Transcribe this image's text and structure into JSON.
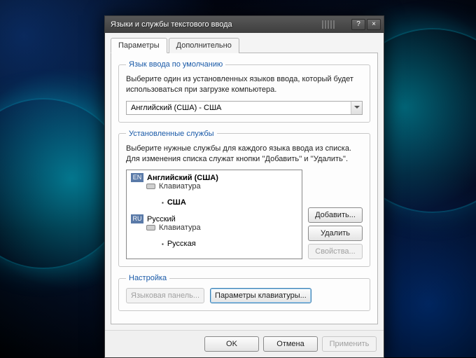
{
  "window": {
    "title": "Языки и службы текстового ввода",
    "help_icon": "?",
    "close_icon": "×"
  },
  "tabs": {
    "params": "Параметры",
    "advanced": "Дополнительно"
  },
  "default_lang": {
    "legend": "Язык ввода по умолчанию",
    "desc": "Выберите один из установленных языков ввода, который будет использоваться при загрузке компьютера.",
    "selected": "Английский (США) - США"
  },
  "installed": {
    "legend": "Установленные службы",
    "desc": "Выберите нужные службы для каждого языка ввода из списка. Для изменения списка служат кнопки ''Добавить'' и ''Удалить''.",
    "langs": [
      {
        "badge": "EN",
        "name": "Английский (США)",
        "bold": true,
        "keyboard_label": "Клавиатура",
        "layouts": [
          {
            "name": "США",
            "bold": true
          }
        ]
      },
      {
        "badge": "RU",
        "name": "Русский",
        "bold": false,
        "keyboard_label": "Клавиатура",
        "layouts": [
          {
            "name": "Русская",
            "bold": false
          }
        ]
      }
    ],
    "buttons": {
      "add": "Добавить...",
      "remove": "Удалить",
      "properties": "Свойства..."
    }
  },
  "settings": {
    "legend": "Настройка",
    "langbar": "Языковая панель...",
    "kbsettings": "Параметры клавиатуры..."
  },
  "footer": {
    "ok": "OK",
    "cancel": "Отмена",
    "apply": "Применить"
  }
}
